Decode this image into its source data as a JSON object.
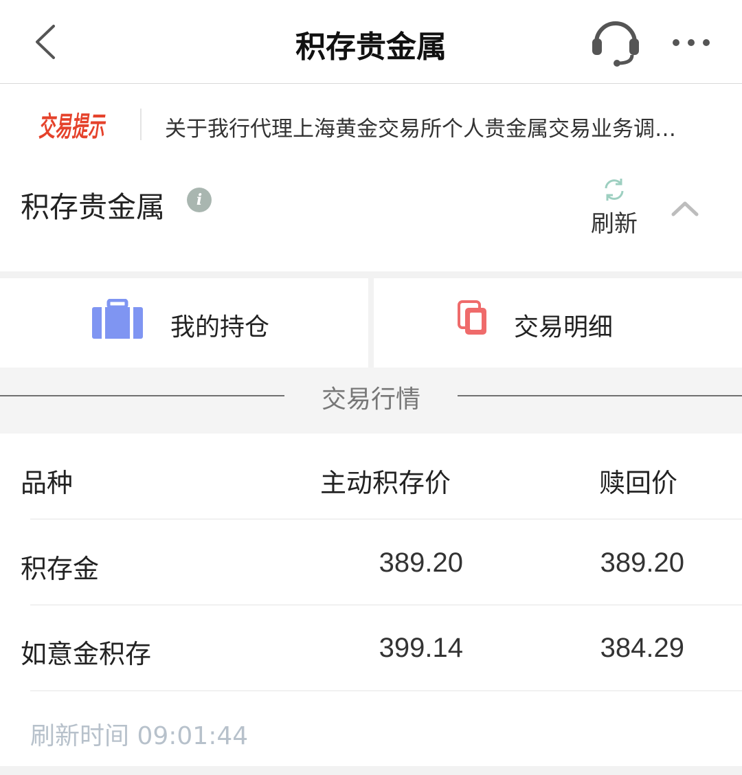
{
  "header": {
    "title": "积存贵金属",
    "back_icon": "chevron-left-icon",
    "service_icon": "headset-icon",
    "more_icon": "more-dots-icon"
  },
  "notice": {
    "badge": "交易提示",
    "text": "关于我行代理上海黄金交易所个人贵金属交易业务调…"
  },
  "section": {
    "title": "积存贵金属",
    "refresh_label": "刷新",
    "collapse_icon": "chevron-up-icon"
  },
  "tiles": [
    {
      "label": "我的持仓",
      "icon": "briefcase-icon",
      "color": "#7f95f2"
    },
    {
      "label": "交易明细",
      "icon": "copy-icon",
      "color": "#ef6b6b"
    }
  ],
  "market": {
    "title": "交易行情",
    "headers": {
      "variety": "品种",
      "buy": "主动积存价",
      "redeem": "赎回价"
    },
    "rows": [
      {
        "name": "积存金",
        "buy": "389.20",
        "redeem": "389.20"
      },
      {
        "name": "如意金积存",
        "buy": "399.14",
        "redeem": "384.29"
      }
    ],
    "refresh_time": "刷新时间 09:01:44"
  },
  "colors": {
    "accent_red": "#e5422b",
    "refresh_icon": "#9dcfc0",
    "refresh_time": "#b7c1cb"
  }
}
